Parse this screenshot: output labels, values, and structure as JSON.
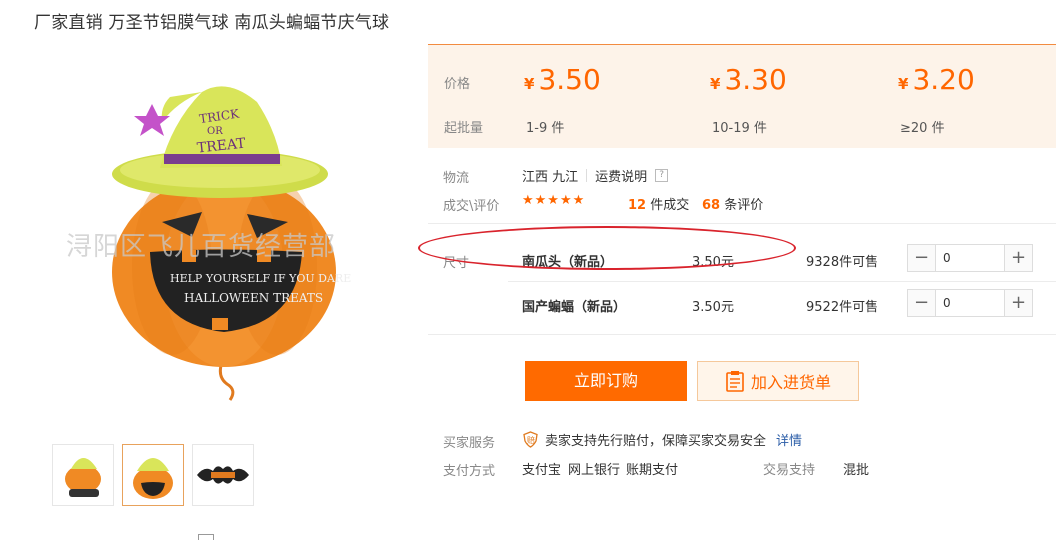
{
  "product": {
    "title": "厂家直销 万圣节铝膜气球 南瓜头蝙蝠节庆气球",
    "watermark": "浔阳区飞儿百货经营部",
    "main_image_icon": "pumpkin-balloon-icon",
    "hat_text": "TRICK OR TREAT",
    "thumbnails": [
      {
        "icon": "pumpkin-balloon-icon",
        "active": false
      },
      {
        "icon": "pumpkin-balloon-icon",
        "active": true
      },
      {
        "icon": "bat-halloween-balloon-icon",
        "active": false
      }
    ]
  },
  "pricing": {
    "price_label": "价格",
    "batch_label": "起批量",
    "currency": "¥",
    "tiers": [
      {
        "price": "3.50",
        "range": "1-9 件"
      },
      {
        "price": "3.30",
        "range": "10-19 件"
      },
      {
        "price": "3.20",
        "range": "≥20 件"
      }
    ]
  },
  "logistics": {
    "label": "物流",
    "location": "江西 九江",
    "shipping_note": "运费说明",
    "help": "?"
  },
  "reviews": {
    "label": "成交\\评价",
    "stars": "★★★★★",
    "deals_count": "12",
    "deals_suffix": "件成交",
    "review_count": "68",
    "review_suffix": "条评价"
  },
  "sku": {
    "label": "尺寸",
    "items": [
      {
        "name": "南瓜头（新品）",
        "price": "3.50元",
        "stock": "9328件可售",
        "qty": "0"
      },
      {
        "name": "国产蝙蝠（新品）",
        "price": "3.50元",
        "stock": "9522件可售",
        "qty": "0"
      }
    ],
    "minus": "−",
    "plus": "+"
  },
  "actions": {
    "order": "立即订购",
    "cart": "加入进货单"
  },
  "service": {
    "label": "买家服务",
    "text": "卖家支持先行赔付，保障买家交易安全",
    "link": "详情"
  },
  "payment": {
    "label": "支付方式",
    "methods": [
      "支付宝",
      "网上银行",
      "账期支付"
    ],
    "trade_label": "交易支持",
    "trade_value": "混批"
  },
  "colors": {
    "accent": "#ff6600",
    "price_bg": "#fdf3e9",
    "annotation": "#d9232c"
  }
}
